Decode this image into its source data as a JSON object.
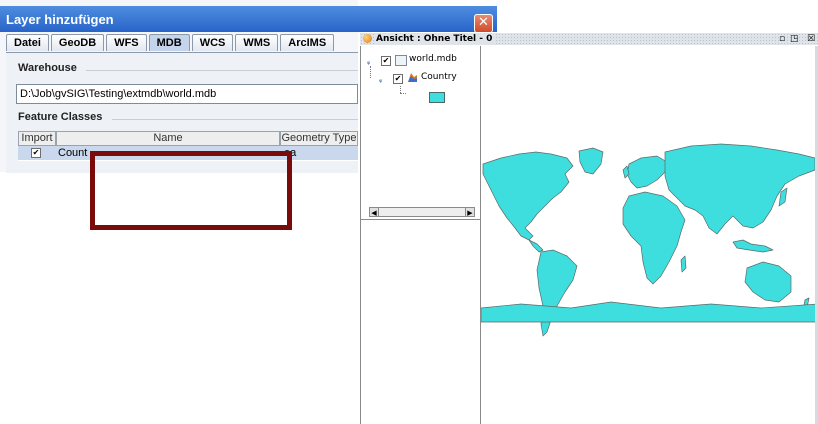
{
  "dialog": {
    "title": "Layer hinzufügen",
    "close_label": "✕",
    "tabs": [
      {
        "label": "Datei"
      },
      {
        "label": "GeoDB"
      },
      {
        "label": "WFS"
      },
      {
        "label": "MDB",
        "active": true
      },
      {
        "label": "WCS"
      },
      {
        "label": "WMS"
      },
      {
        "label": "ArcIMS"
      }
    ],
    "warehouse": {
      "label": "Warehouse",
      "path": "D:\\Job\\gvSIG\\Testing\\extmdb\\world.mdb"
    },
    "feature_classes": {
      "label": "Feature Classes",
      "columns": [
        "Import",
        "Name",
        "Geometry Type"
      ],
      "rows": [
        {
          "import_checked": "✔",
          "name": "Count",
          "geometry_type": "ea"
        }
      ]
    }
  },
  "view": {
    "title": "Ansicht : Ohne Titel - 0",
    "minimize_label": "▫",
    "maximize_label": "◳",
    "close_label": "☒",
    "toc": {
      "items": [
        {
          "label": "world.mdb",
          "checked": "✔",
          "icon": "database-icon"
        },
        {
          "label": "Country",
          "checked": "✔",
          "icon": "polygon-layer-icon",
          "legend_color": "#3fdede"
        }
      ]
    },
    "map": {
      "land_color": "#3fdede",
      "border_color": "#5a6a6a"
    }
  },
  "annotation": {
    "highlight_color": "#7a0b0b"
  }
}
